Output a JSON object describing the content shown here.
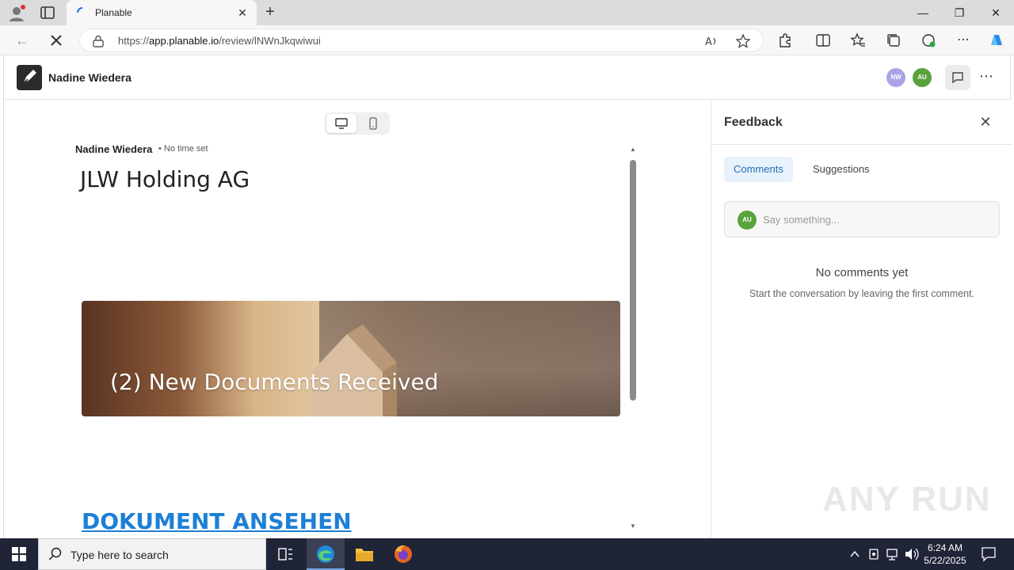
{
  "browser": {
    "tab_title": "Planable",
    "url_prefix": "https://",
    "url_host": "app.planable.io",
    "url_path": "/review/lNWnJkqwiwui"
  },
  "app": {
    "workspace_name": "Nadine Wiedera",
    "avatars": [
      {
        "initials": "NW",
        "color": "#a9a3e8"
      },
      {
        "initials": "AU",
        "color": "#59a33a"
      }
    ]
  },
  "post": {
    "author": "Nadine Wiedera",
    "time": "• No time set",
    "heading": "JLW Holding AG",
    "banner_caption": "(2) New Documents Received",
    "cta": "DOKUMENT ANSEHEN"
  },
  "feedback": {
    "title": "Feedback",
    "tabs": [
      {
        "label": "Comments",
        "active": true
      },
      {
        "label": "Suggestions",
        "active": false
      }
    ],
    "composer_initials": "AU",
    "composer_placeholder": "Say something...",
    "empty_title": "No comments yet",
    "empty_subtitle": "Start the conversation by leaving the first comment."
  },
  "watermark": "ANY RUN",
  "taskbar": {
    "search_placeholder": "Type here to search",
    "time": "6:24 AM",
    "date": "5/22/2025"
  },
  "colors": {
    "accent": "#1d7fd6",
    "taskbar": "#1f2436"
  }
}
